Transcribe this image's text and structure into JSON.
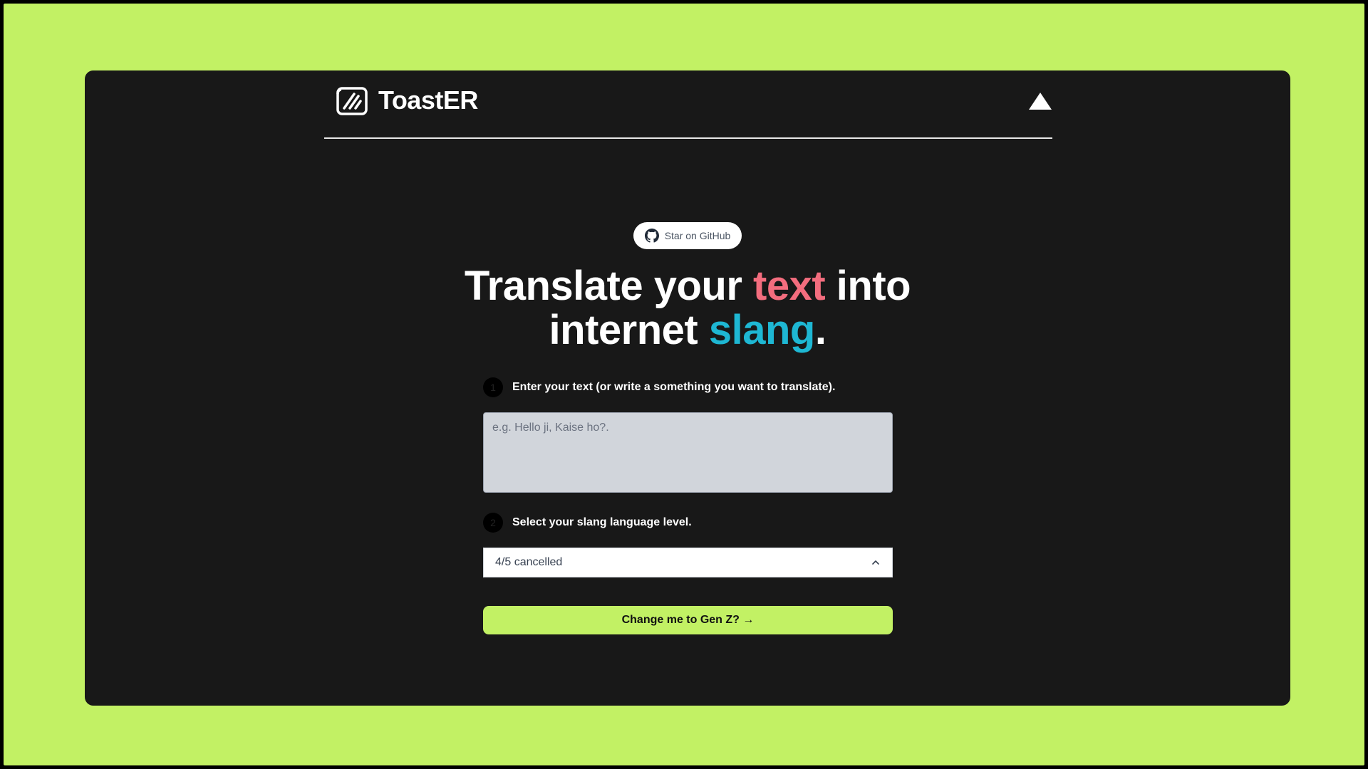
{
  "header": {
    "brand": "ToastER",
    "logo_icon": "toast-logo-icon",
    "right_icon": "vercel-triangle-icon"
  },
  "star_button": {
    "label": "Star on GitHub",
    "icon": "github-icon"
  },
  "headline": {
    "part1": "Translate your ",
    "highlight1": "text",
    "part2": " into",
    "part3": "internet ",
    "highlight2": "slang",
    "part4": "."
  },
  "step1": {
    "number": "1",
    "label": "Enter your text (or write a something you want to translate)."
  },
  "text_input": {
    "placeholder": "e.g. Hello ji, Kaise ho?.",
    "value": ""
  },
  "step2": {
    "number": "2",
    "label": "Select your slang language level."
  },
  "slang_select": {
    "value": "4/5 cancelled",
    "icon": "chevron-up-icon"
  },
  "cta": {
    "label": "Change me to Gen Z? →"
  },
  "colors": {
    "page_bg": "#c2f164",
    "card_bg": "#181818",
    "pink": "#f36d7e",
    "cyan": "#1eb7d3",
    "cta_bg": "#c2f164"
  }
}
